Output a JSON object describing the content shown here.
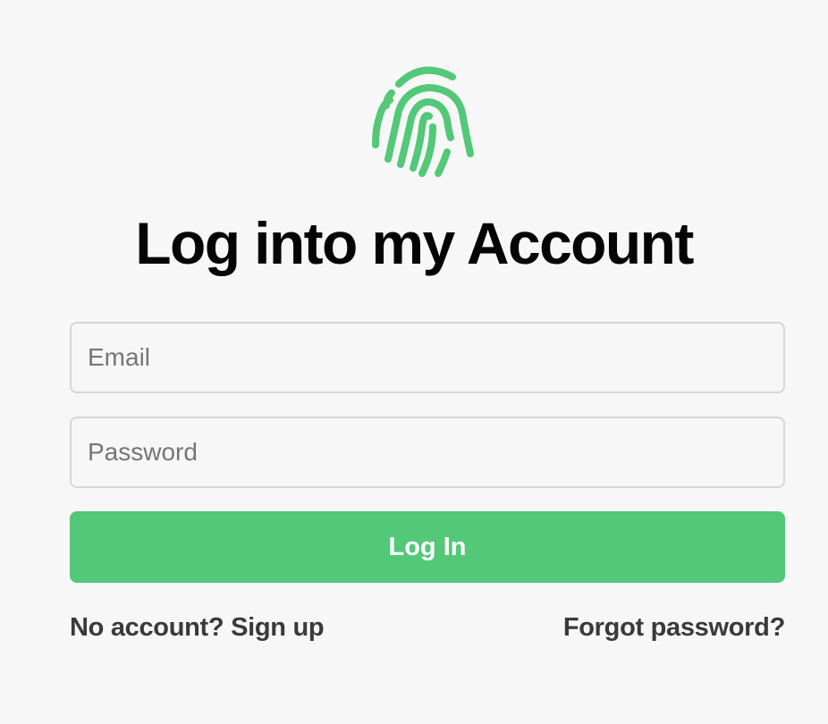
{
  "logo": {
    "icon": "fingerprint-icon",
    "color": "#52c878"
  },
  "title": "Log into my Account",
  "form": {
    "email_placeholder": "Email",
    "email_value": "",
    "password_placeholder": "Password",
    "password_value": "",
    "submit_label": "Log In",
    "submit_color": "#52c878"
  },
  "links": {
    "signup": "No account? Sign up",
    "forgot": "Forgot password?"
  }
}
